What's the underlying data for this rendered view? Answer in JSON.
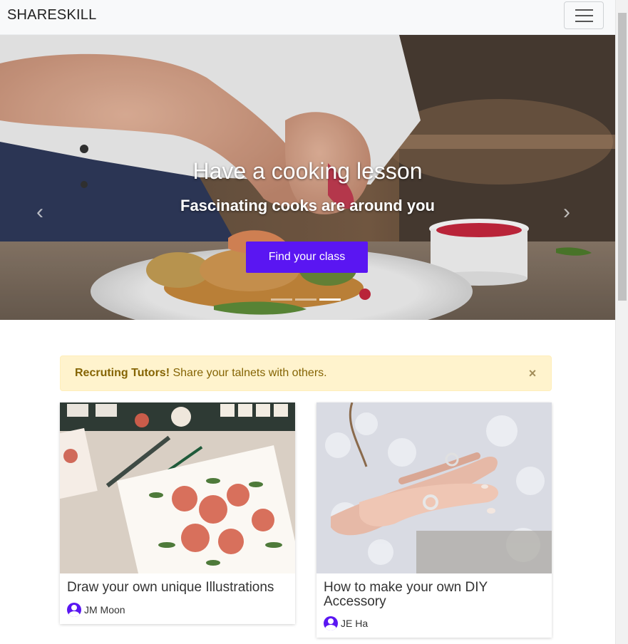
{
  "navbar": {
    "brand": "SHARESKILL",
    "toggle_icon": "hamburger-menu-icon"
  },
  "hero": {
    "title": "Have a cooking lesson",
    "subtitle": "Fascinating cooks are around you",
    "cta_label": "Find your class",
    "prev_icon": "chevron-left-icon",
    "next_icon": "chevron-right-icon",
    "slides": 3,
    "active_slide": 3,
    "accent_color": "#5a16f2"
  },
  "alert": {
    "strong": "Recruting Tutors!",
    "message": " Share your talnets with others.",
    "close_label": "×"
  },
  "cards": [
    {
      "title": "Draw your own unique Illustrations",
      "author": "JM Moon"
    },
    {
      "title": "How to make your own DIY Accessory",
      "author": "JE Ha"
    }
  ]
}
